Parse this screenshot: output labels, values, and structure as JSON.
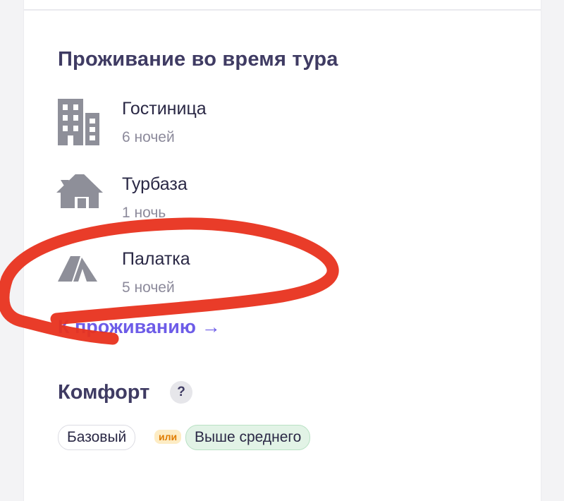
{
  "accommodation": {
    "title": "Проживание во время тура",
    "items": [
      {
        "icon": "hotel-icon",
        "name": "Гостиница",
        "nights": "6 ночей"
      },
      {
        "icon": "house-icon",
        "name": "Турбаза",
        "nights": "1 ночь"
      },
      {
        "icon": "tent-icon",
        "name": "Палатка",
        "nights": "5 ночей"
      }
    ],
    "link_label": "К проживанию",
    "link_arrow": "→"
  },
  "comfort": {
    "title": "Комфорт",
    "help_label": "?",
    "level_from": "Базовый",
    "or_label": "или",
    "level_to": "Выше среднего"
  },
  "colors": {
    "heading": "#3f3b63",
    "link": "#6d5ce8",
    "icon": "#8e8f99",
    "marker": "#e8321e",
    "or_badge_bg": "#fdecc4",
    "or_badge_text": "#e07c00",
    "chip_green_bg": "#e2f3e6"
  }
}
